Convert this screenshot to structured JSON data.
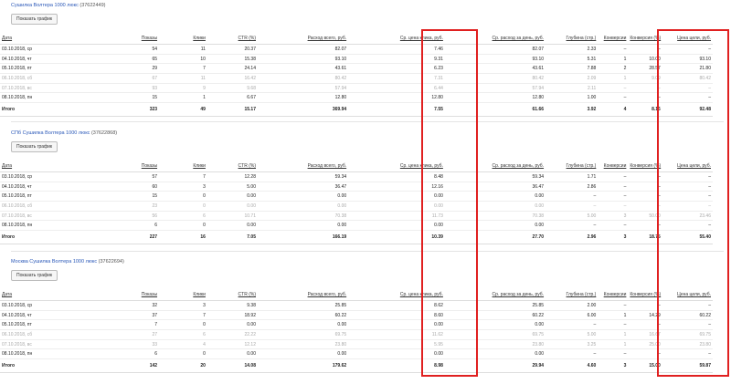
{
  "button_label": "Показать график",
  "columns": [
    "Дата",
    "Показы",
    "Клики",
    "CTR (%)",
    "Расход всего, руб.",
    "Ср. цена клика, руб.",
    "Ср. расход за день, руб.",
    "Глубина (стр.)",
    "Конверсии",
    "Конверсия (%)",
    "Цена цели, руб."
  ],
  "campaigns": [
    {
      "name": "Сушилка Волтера 1000 люкс",
      "id": "(37622449)",
      "rows": [
        {
          "date": "03.10.2018, ср",
          "shows": "54",
          "clicks": "11",
          "ctr": "20.37",
          "cost": "82.07",
          "cpc": "7.46",
          "daily": "82.07",
          "depth": "2.33",
          "conv": "–",
          "conv_pct": "–",
          "goal_cost": "–",
          "weekend": false
        },
        {
          "date": "04.10.2018, чт",
          "shows": "65",
          "clicks": "10",
          "ctr": "15.38",
          "cost": "93.10",
          "cpc": "9.31",
          "daily": "93.10",
          "depth": "5.31",
          "conv": "1",
          "conv_pct": "10.00",
          "goal_cost": "93.10",
          "weekend": false
        },
        {
          "date": "05.10.2018, пт",
          "shows": "29",
          "clicks": "7",
          "ctr": "24.14",
          "cost": "43.61",
          "cpc": "6.23",
          "daily": "43.61",
          "depth": "7.88",
          "conv": "2",
          "conv_pct": "28.57",
          "goal_cost": "21.80",
          "weekend": false
        },
        {
          "date": "06.10.2018, сб",
          "shows": "67",
          "clicks": "11",
          "ctr": "16.42",
          "cost": "80.42",
          "cpc": "7.31",
          "daily": "80.42",
          "depth": "2.09",
          "conv": "1",
          "conv_pct": "9.09",
          "goal_cost": "80.42",
          "weekend": true
        },
        {
          "date": "07.10.2018, вс",
          "shows": "93",
          "clicks": "9",
          "ctr": "9.68",
          "cost": "57.94",
          "cpc": "6.44",
          "daily": "57.94",
          "depth": "2.11",
          "conv": "–",
          "conv_pct": "–",
          "goal_cost": "–",
          "weekend": true
        },
        {
          "date": "08.10.2018, пн",
          "shows": "15",
          "clicks": "1",
          "ctr": "6.67",
          "cost": "12.80",
          "cpc": "12.80",
          "daily": "12.80",
          "depth": "1.00",
          "conv": "–",
          "conv_pct": "–",
          "goal_cost": "–",
          "weekend": false
        }
      ],
      "total": {
        "label": "Итого",
        "shows": "323",
        "clicks": "49",
        "ctr": "15.17",
        "cost": "369.94",
        "cpc": "7.55",
        "daily": "61.66",
        "depth": "3.92",
        "conv": "4",
        "conv_pct": "8.16",
        "goal_cost": "92.48"
      }
    },
    {
      "name": "СПб Сушилка Волтера 1000 люкс",
      "id": "(37622868)",
      "rows": [
        {
          "date": "03.10.2018, ср",
          "shows": "57",
          "clicks": "7",
          "ctr": "12.28",
          "cost": "59.34",
          "cpc": "8.48",
          "daily": "59.34",
          "depth": "1.71",
          "conv": "–",
          "conv_pct": "–",
          "goal_cost": "–",
          "weekend": false
        },
        {
          "date": "04.10.2018, чт",
          "shows": "60",
          "clicks": "3",
          "ctr": "5.00",
          "cost": "36.47",
          "cpc": "12.16",
          "daily": "36.47",
          "depth": "2.86",
          "conv": "–",
          "conv_pct": "–",
          "goal_cost": "–",
          "weekend": false
        },
        {
          "date": "05.10.2018, пт",
          "shows": "15",
          "clicks": "0",
          "ctr": "0.00",
          "cost": "0.00",
          "cpc": "0.00",
          "daily": "0.00",
          "depth": "–",
          "conv": "–",
          "conv_pct": "–",
          "goal_cost": "–",
          "weekend": false
        },
        {
          "date": "06.10.2018, сб",
          "shows": "23",
          "clicks": "0",
          "ctr": "0.00",
          "cost": "0.00",
          "cpc": "0.00",
          "daily": "0.00",
          "depth": "–",
          "conv": "–",
          "conv_pct": "–",
          "goal_cost": "–",
          "weekend": true
        },
        {
          "date": "07.10.2018, вс",
          "shows": "56",
          "clicks": "6",
          "ctr": "10.71",
          "cost": "70.38",
          "cpc": "11.73",
          "daily": "70.38",
          "depth": "5.00",
          "conv": "3",
          "conv_pct": "50.00",
          "goal_cost": "23.46",
          "weekend": true
        },
        {
          "date": "08.10.2018, пн",
          "shows": "6",
          "clicks": "0",
          "ctr": "0.00",
          "cost": "0.00",
          "cpc": "0.00",
          "daily": "0.00",
          "depth": "–",
          "conv": "–",
          "conv_pct": "–",
          "goal_cost": "–",
          "weekend": false
        }
      ],
      "total": {
        "label": "Итого",
        "shows": "227",
        "clicks": "16",
        "ctr": "7.05",
        "cost": "166.19",
        "cpc": "10.39",
        "daily": "27.70",
        "depth": "2.96",
        "conv": "3",
        "conv_pct": "18.75",
        "goal_cost": "55.40"
      }
    },
    {
      "name": "Москва Сушилка Волтера 1000 люкс",
      "id": "(37622694)",
      "rows": [
        {
          "date": "03.10.2018, ср",
          "shows": "32",
          "clicks": "3",
          "ctr": "9.38",
          "cost": "25.85",
          "cpc": "8.62",
          "daily": "25.85",
          "depth": "2.00",
          "conv": "–",
          "conv_pct": "–",
          "goal_cost": "–",
          "weekend": false
        },
        {
          "date": "04.10.2018, чт",
          "shows": "37",
          "clicks": "7",
          "ctr": "18.92",
          "cost": "60.22",
          "cpc": "8.60",
          "daily": "60.22",
          "depth": "6.00",
          "conv": "1",
          "conv_pct": "14.29",
          "goal_cost": "60.22",
          "weekend": false
        },
        {
          "date": "05.10.2018, пт",
          "shows": "7",
          "clicks": "0",
          "ctr": "0.00",
          "cost": "0.00",
          "cpc": "0.00",
          "daily": "0.00",
          "depth": "–",
          "conv": "–",
          "conv_pct": "–",
          "goal_cost": "–",
          "weekend": false
        },
        {
          "date": "06.10.2018, сб",
          "shows": "27",
          "clicks": "6",
          "ctr": "22.22",
          "cost": "69.75",
          "cpc": "11.62",
          "daily": "69.75",
          "depth": "5.00",
          "conv": "1",
          "conv_pct": "16.67",
          "goal_cost": "69.75",
          "weekend": true
        },
        {
          "date": "07.10.2018, вс",
          "shows": "33",
          "clicks": "4",
          "ctr": "12.12",
          "cost": "23.80",
          "cpc": "5.95",
          "daily": "23.80",
          "depth": "3.25",
          "conv": "1",
          "conv_pct": "25.00",
          "goal_cost": "23.80",
          "weekend": true
        },
        {
          "date": "08.10.2018, пн",
          "shows": "6",
          "clicks": "0",
          "ctr": "0.00",
          "cost": "0.00",
          "cpc": "0.00",
          "daily": "0.00",
          "depth": "–",
          "conv": "–",
          "conv_pct": "–",
          "goal_cost": "–",
          "weekend": false
        }
      ],
      "total": {
        "label": "Итого",
        "shows": "142",
        "clicks": "20",
        "ctr": "14.08",
        "cost": "179.62",
        "cpc": "8.98",
        "daily": "29.94",
        "depth": "4.60",
        "conv": "3",
        "conv_pct": "15.00",
        "goal_cost": "59.87"
      }
    }
  ],
  "colors": {
    "link": "#2a58b8",
    "highlight": "#e02020",
    "weekend_text": "#aaaaaa"
  }
}
